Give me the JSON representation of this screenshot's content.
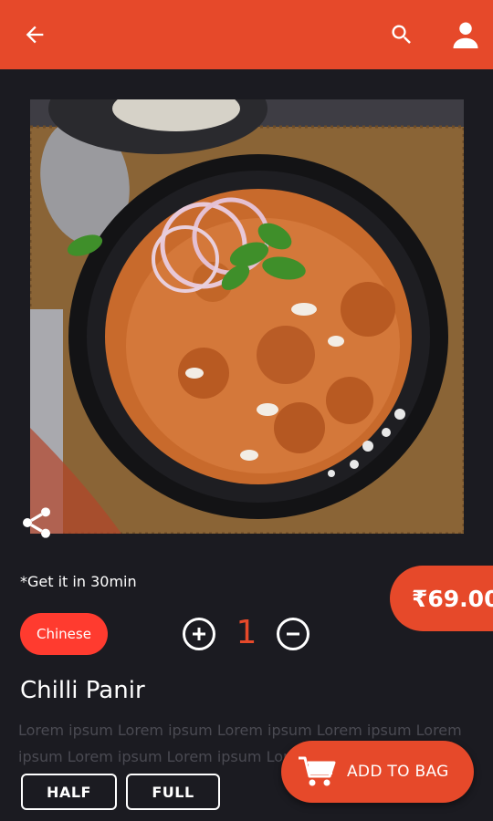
{
  "header": {
    "back_icon": "arrow-left-icon",
    "search_icon": "search-icon",
    "profile_icon": "user-icon",
    "background": "#e6492a"
  },
  "product": {
    "image_alt": "Chilli Panir dish",
    "share_icon": "share-icon",
    "delivery_note": "*Get it in 30min",
    "price": "₹69.00",
    "category": "Chinese",
    "quantity": "1",
    "name": "Chilli Panir",
    "description": "Lorem ipsum Lorem ipsum Lorem ipsum Lorem ipsum Lorem ipsum Lorem ipsum Lorem ipsum Lorem ipsum"
  },
  "sizes": [
    {
      "label": "HALF"
    },
    {
      "label": "FULL"
    }
  ],
  "cart": {
    "label": "ADD TO BAG",
    "icon": "cart-icon"
  },
  "colors": {
    "accent": "#e6492a",
    "tag": "#ff3b2f",
    "background": "#1b1b21"
  }
}
